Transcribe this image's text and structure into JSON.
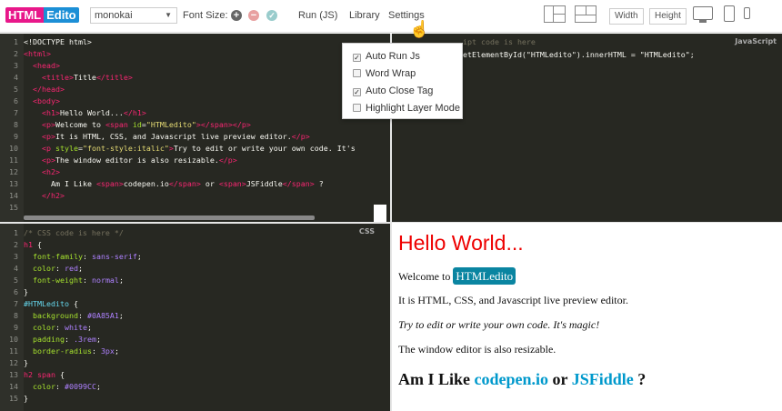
{
  "toolbar": {
    "logo_a": "HTML",
    "logo_b": "Edito",
    "theme": "monokai",
    "font_size_label": "Font Size:",
    "run_label": "Run (JS)",
    "library_label": "Library",
    "settings_label": "Settings",
    "width_label": "Width",
    "height_label": "Height"
  },
  "settings_menu": {
    "items": [
      {
        "label": "Auto Run Js",
        "checked": true
      },
      {
        "label": "Word Wrap",
        "checked": false
      },
      {
        "label": "Auto Close Tag",
        "checked": true
      },
      {
        "label": "Highlight Layer Mode",
        "checked": false
      }
    ]
  },
  "js_pane": {
    "label": "JavaScript",
    "placeholder": "ipt code is here",
    "code": "etElementById(\"HTMLedito\").innerHTML = \"HTMLedito\";"
  },
  "css_pane": {
    "label": "CSS"
  },
  "preview": {
    "h1": "Hello World...",
    "welcome": "Welcome to ",
    "span": "HTMLedito",
    "p2": "It is HTML, CSS, and Javascript live preview editor.",
    "p3": "Try to edit or write your own code. It's magic!",
    "p4": "The window editor is also resizable.",
    "h2_a": "Am I Like ",
    "h2_b": "codepen.io",
    "h2_c": " or ",
    "h2_d": "JSFiddle",
    "h2_e": " ?"
  },
  "colors": {
    "accent": "#0A85A1",
    "pink": "#e8178a",
    "h1": "#ff0000",
    "link": "#0099CC"
  }
}
